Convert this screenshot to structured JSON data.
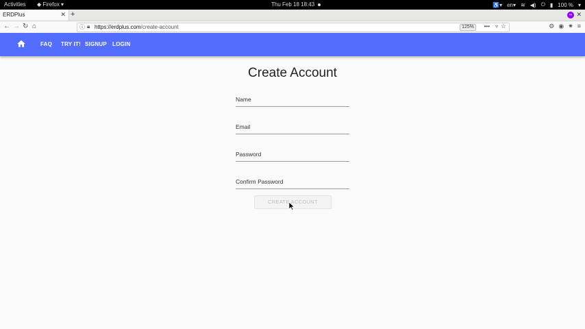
{
  "system_bar": {
    "activities": "Activities",
    "app_menu": "Firefox",
    "clock": "Thu Feb 18  18:43",
    "keyboard_layout": "en",
    "battery": "100 %"
  },
  "browser": {
    "tab_title": "ERDPlus",
    "url_host": "https://erdplus.com",
    "url_path": "/create-account",
    "zoom": "125%"
  },
  "app_nav": {
    "links": [
      "FAQ",
      "TRY IT!",
      "SIGNUP",
      "LOGIN"
    ],
    "accent_color": "#536dfe"
  },
  "form": {
    "title": "Create Account",
    "name_placeholder": "Name",
    "email_placeholder": "Email",
    "password_placeholder": "Password",
    "confirm_placeholder": "Confirm Password",
    "submit_label": "CREATE ACCOUNT"
  }
}
